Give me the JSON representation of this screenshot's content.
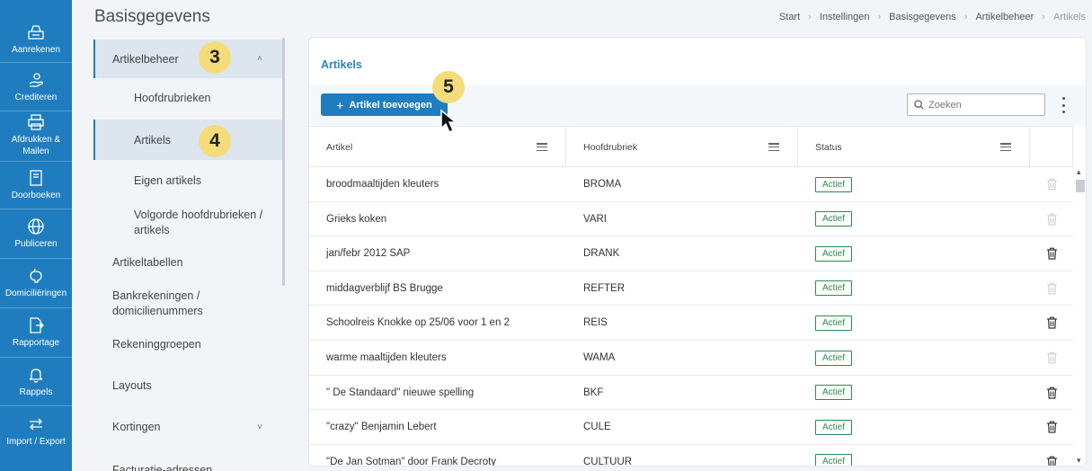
{
  "rail": {
    "items": [
      {
        "label": "Aanrekenen",
        "icon": "cash-register-icon"
      },
      {
        "label": "Crediteren",
        "icon": "hand-money-icon"
      },
      {
        "label": "Afdrukken & Mailen",
        "icon": "printer-icon"
      },
      {
        "label": "Doorboeken",
        "icon": "book-icon"
      },
      {
        "label": "Publiceren",
        "icon": "globe-icon"
      },
      {
        "label": "Domiciliëringen",
        "icon": "piggy-bank-icon"
      },
      {
        "label": "Rapportage",
        "icon": "export-file-icon"
      },
      {
        "label": "Rappels",
        "icon": "bell-icon"
      },
      {
        "label": "Import / Export",
        "icon": "swap-arrows-icon"
      }
    ]
  },
  "header": {
    "title": "Basisgegevens",
    "breadcrumb": [
      "Start",
      "Instellingen",
      "Basisgegevens",
      "Artikelbeheer",
      "Artikels"
    ]
  },
  "subnav": {
    "items": [
      {
        "label": "Artikelbeheer"
      },
      {
        "label": "Hoofdrubrieken"
      },
      {
        "label": "Artikels"
      },
      {
        "label": "Eigen artikels"
      },
      {
        "label": "Volgorde hoofdrubrieken / artikels"
      },
      {
        "label": "Artikeltabellen"
      },
      {
        "label": "Bankrekeningen / domicilienummers"
      },
      {
        "label": "Rekeninggroepen"
      },
      {
        "label": "Layouts"
      },
      {
        "label": "Kortingen"
      },
      {
        "label": "Facturatie-adressen"
      }
    ]
  },
  "annotations": {
    "badge3": "3",
    "badge4": "4",
    "badge5": "5"
  },
  "card": {
    "title": "Artikels",
    "add_button": "Artikel toevoegen",
    "search_placeholder": "Zoeken",
    "columns": [
      "Artikel",
      "Hoofdrubriek",
      "Status"
    ],
    "rows": [
      {
        "artikel": "broodmaaltijden kleuters",
        "hoofdrubriek": "BROMA",
        "status": "Actief",
        "delete_enabled": false
      },
      {
        "artikel": "Grieks koken",
        "hoofdrubriek": "VARI",
        "status": "Actief",
        "delete_enabled": false
      },
      {
        "artikel": "jan/febr 2012 SAP",
        "hoofdrubriek": "DRANK",
        "status": "Actief",
        "delete_enabled": true
      },
      {
        "artikel": "middagverblijf BS Brugge",
        "hoofdrubriek": "REFTER",
        "status": "Actief",
        "delete_enabled": false
      },
      {
        "artikel": "Schoolreis Knokke op 25/06 voor 1 en 2",
        "hoofdrubriek": "REIS",
        "status": "Actief",
        "delete_enabled": true
      },
      {
        "artikel": "warme maaltijden kleuters",
        "hoofdrubriek": "WAMA",
        "status": "Actief",
        "delete_enabled": false
      },
      {
        "artikel": "\" De Standaard\" nieuwe spelling",
        "hoofdrubriek": "BKF",
        "status": "Actief",
        "delete_enabled": true
      },
      {
        "artikel": "\"crazy\" Benjamin Lebert",
        "hoofdrubriek": "CULE",
        "status": "Actief",
        "delete_enabled": true
      },
      {
        "artikel": "\"De Jan Sotman\" door Frank Decroty",
        "hoofdrubriek": "CULTUUR",
        "status": "Actief",
        "delete_enabled": true
      }
    ]
  },
  "colors": {
    "accent": "#1f7dbf",
    "active_status": "#2f8a4a",
    "badge": "#f5dc7a"
  }
}
